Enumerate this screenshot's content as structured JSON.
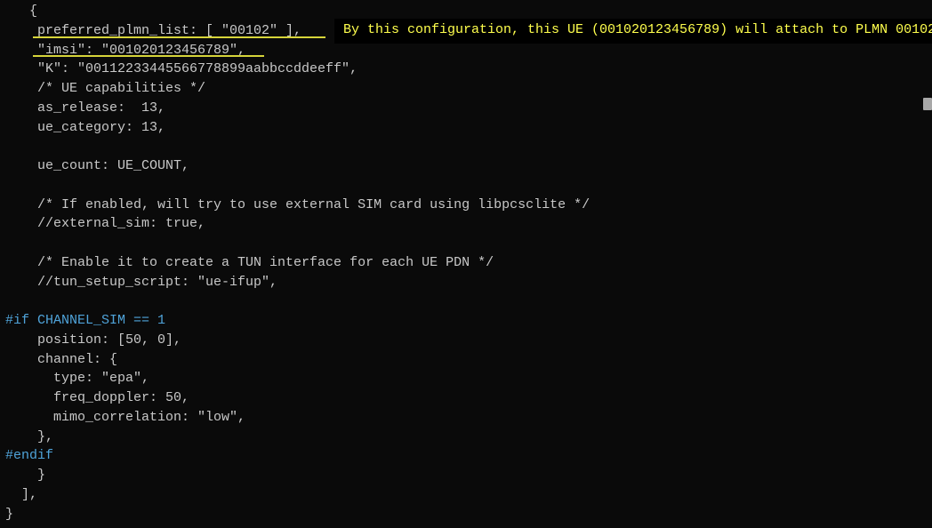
{
  "code": {
    "l01": "   {",
    "l02": "    preferred_plmn_list: [ \"00102\" ],",
    "l03": "    \"imsi\": \"001020123456789\",",
    "l04": "    \"K\": \"00112233445566778899aabbccddeeff\",",
    "l05": "    /* UE capabilities */",
    "l06": "    as_release:  13,",
    "l07": "    ue_category: 13,",
    "l08": "",
    "l09": "    ue_count: UE_COUNT,",
    "l10": "",
    "l11": "    /* If enabled, will try to use external SIM card using libpcsclite */",
    "l12": "    //external_sim: true,",
    "l13": "",
    "l14": "    /* Enable it to create a TUN interface for each UE PDN */",
    "l15": "    //tun_setup_script: \"ue-ifup\",",
    "l16": "",
    "l17": "#if CHANNEL_SIM == 1",
    "l18": "    position: [50, 0],",
    "l19": "    channel: {",
    "l20": "      type: \"epa\",",
    "l21": "      freq_doppler: 50,",
    "l22": "      mimo_correlation: \"low\",",
    "l23": "    },",
    "l24": "#endif",
    "l25": "    }",
    "l26": "  ],",
    "l27": "}"
  },
  "annotation": "By this configuration, this UE (001020123456789) will attach to PLMN 00102"
}
